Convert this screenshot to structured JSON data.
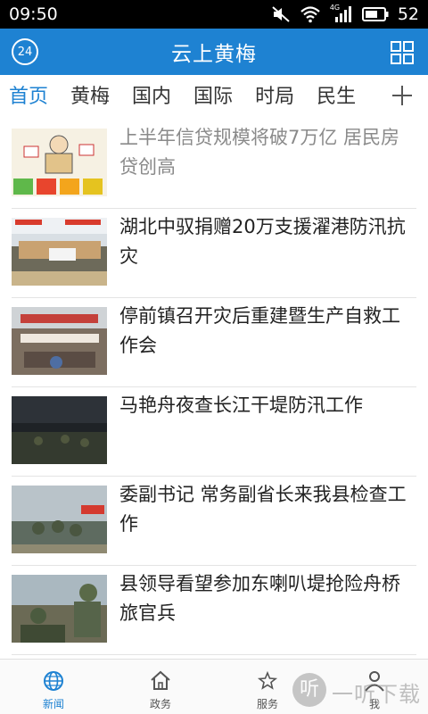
{
  "status_bar": {
    "time": "09:50",
    "battery": "52",
    "network_label": "4G"
  },
  "header": {
    "badge": "24",
    "title": "云上黄梅"
  },
  "tabs": [
    {
      "label": "首页",
      "active": true
    },
    {
      "label": "黄梅"
    },
    {
      "label": "国内"
    },
    {
      "label": "国际"
    },
    {
      "label": "时局"
    },
    {
      "label": "民生"
    }
  ],
  "news": [
    {
      "title": "上半年信贷规模将破7万亿 居民房贷创高",
      "read": true
    },
    {
      "title": "湖北中驭捐赠20万支援濯港防汛抗灾"
    },
    {
      "title": "停前镇召开灾后重建暨生产自救工作会"
    },
    {
      "title": "马艳舟夜查长江干堤防汛工作"
    },
    {
      "title": "委副书记 常务副省长来我县检查工作"
    },
    {
      "title": "县领导看望参加东喇叭堤抢险舟桥旅官兵"
    }
  ],
  "bottom_nav": [
    {
      "label": "新闻",
      "icon": "globe-icon",
      "active": true
    },
    {
      "label": "政务",
      "icon": "home-icon"
    },
    {
      "label": "服务",
      "icon": "service-icon"
    },
    {
      "label": "我",
      "icon": "person-icon"
    }
  ],
  "watermark": {
    "circle_char": "听",
    "text": "一听下载"
  },
  "colors": {
    "primary": "#1e82d2",
    "read_text": "#8a8a8a"
  }
}
